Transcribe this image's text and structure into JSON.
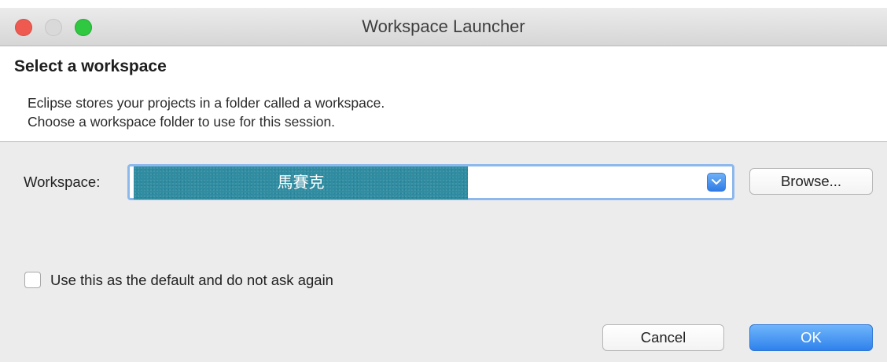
{
  "window": {
    "title": "Workspace Launcher"
  },
  "header": {
    "title": "Select a workspace",
    "description_lines": [
      "Eclipse stores your projects in a folder called a workspace.",
      "Choose a workspace folder to use for this session."
    ]
  },
  "workspace": {
    "label": "Workspace:",
    "value": "馬賽克",
    "browse_label": "Browse..."
  },
  "options": {
    "default_label": "Use this as the default and do not ask again",
    "default_checked": false
  },
  "footer": {
    "cancel_label": "Cancel",
    "ok_label": "OK"
  },
  "colors": {
    "accent": "#2f82ec",
    "close": "#ee5a50",
    "maximize": "#2fc840",
    "redaction": "#2f8ca1"
  }
}
